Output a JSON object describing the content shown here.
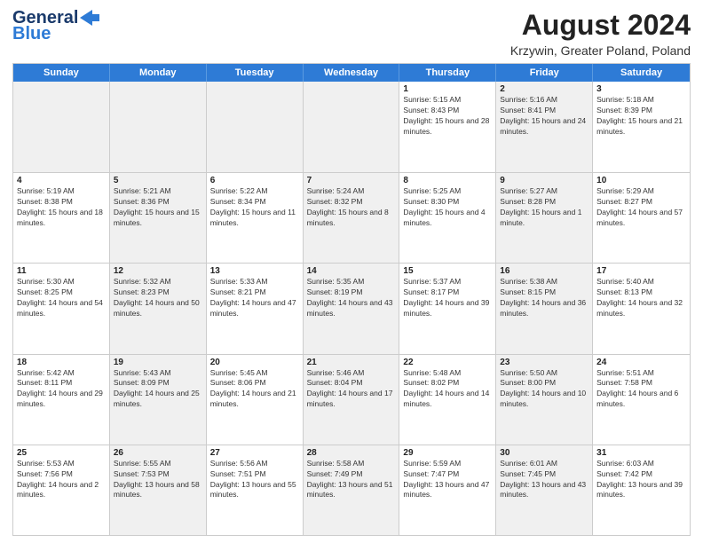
{
  "header": {
    "logo_line1": "General",
    "logo_line2": "Blue",
    "month_year": "August 2024",
    "location": "Krzywin, Greater Poland, Poland"
  },
  "days_of_week": [
    "Sunday",
    "Monday",
    "Tuesday",
    "Wednesday",
    "Thursday",
    "Friday",
    "Saturday"
  ],
  "weeks": [
    [
      {
        "day": "",
        "sunrise": "",
        "sunset": "",
        "daylight": "",
        "shaded": true
      },
      {
        "day": "",
        "sunrise": "",
        "sunset": "",
        "daylight": "",
        "shaded": true
      },
      {
        "day": "",
        "sunrise": "",
        "sunset": "",
        "daylight": "",
        "shaded": true
      },
      {
        "day": "",
        "sunrise": "",
        "sunset": "",
        "daylight": "",
        "shaded": true
      },
      {
        "day": "1",
        "sunrise": "Sunrise: 5:15 AM",
        "sunset": "Sunset: 8:43 PM",
        "daylight": "Daylight: 15 hours and 28 minutes.",
        "shaded": false
      },
      {
        "day": "2",
        "sunrise": "Sunrise: 5:16 AM",
        "sunset": "Sunset: 8:41 PM",
        "daylight": "Daylight: 15 hours and 24 minutes.",
        "shaded": true
      },
      {
        "day": "3",
        "sunrise": "Sunrise: 5:18 AM",
        "sunset": "Sunset: 8:39 PM",
        "daylight": "Daylight: 15 hours and 21 minutes.",
        "shaded": false
      }
    ],
    [
      {
        "day": "4",
        "sunrise": "Sunrise: 5:19 AM",
        "sunset": "Sunset: 8:38 PM",
        "daylight": "Daylight: 15 hours and 18 minutes.",
        "shaded": false
      },
      {
        "day": "5",
        "sunrise": "Sunrise: 5:21 AM",
        "sunset": "Sunset: 8:36 PM",
        "daylight": "Daylight: 15 hours and 15 minutes.",
        "shaded": true
      },
      {
        "day": "6",
        "sunrise": "Sunrise: 5:22 AM",
        "sunset": "Sunset: 8:34 PM",
        "daylight": "Daylight: 15 hours and 11 minutes.",
        "shaded": false
      },
      {
        "day": "7",
        "sunrise": "Sunrise: 5:24 AM",
        "sunset": "Sunset: 8:32 PM",
        "daylight": "Daylight: 15 hours and 8 minutes.",
        "shaded": true
      },
      {
        "day": "8",
        "sunrise": "Sunrise: 5:25 AM",
        "sunset": "Sunset: 8:30 PM",
        "daylight": "Daylight: 15 hours and 4 minutes.",
        "shaded": false
      },
      {
        "day": "9",
        "sunrise": "Sunrise: 5:27 AM",
        "sunset": "Sunset: 8:28 PM",
        "daylight": "Daylight: 15 hours and 1 minute.",
        "shaded": true
      },
      {
        "day": "10",
        "sunrise": "Sunrise: 5:29 AM",
        "sunset": "Sunset: 8:27 PM",
        "daylight": "Daylight: 14 hours and 57 minutes.",
        "shaded": false
      }
    ],
    [
      {
        "day": "11",
        "sunrise": "Sunrise: 5:30 AM",
        "sunset": "Sunset: 8:25 PM",
        "daylight": "Daylight: 14 hours and 54 minutes.",
        "shaded": false
      },
      {
        "day": "12",
        "sunrise": "Sunrise: 5:32 AM",
        "sunset": "Sunset: 8:23 PM",
        "daylight": "Daylight: 14 hours and 50 minutes.",
        "shaded": true
      },
      {
        "day": "13",
        "sunrise": "Sunrise: 5:33 AM",
        "sunset": "Sunset: 8:21 PM",
        "daylight": "Daylight: 14 hours and 47 minutes.",
        "shaded": false
      },
      {
        "day": "14",
        "sunrise": "Sunrise: 5:35 AM",
        "sunset": "Sunset: 8:19 PM",
        "daylight": "Daylight: 14 hours and 43 minutes.",
        "shaded": true
      },
      {
        "day": "15",
        "sunrise": "Sunrise: 5:37 AM",
        "sunset": "Sunset: 8:17 PM",
        "daylight": "Daylight: 14 hours and 39 minutes.",
        "shaded": false
      },
      {
        "day": "16",
        "sunrise": "Sunrise: 5:38 AM",
        "sunset": "Sunset: 8:15 PM",
        "daylight": "Daylight: 14 hours and 36 minutes.",
        "shaded": true
      },
      {
        "day": "17",
        "sunrise": "Sunrise: 5:40 AM",
        "sunset": "Sunset: 8:13 PM",
        "daylight": "Daylight: 14 hours and 32 minutes.",
        "shaded": false
      }
    ],
    [
      {
        "day": "18",
        "sunrise": "Sunrise: 5:42 AM",
        "sunset": "Sunset: 8:11 PM",
        "daylight": "Daylight: 14 hours and 29 minutes.",
        "shaded": false
      },
      {
        "day": "19",
        "sunrise": "Sunrise: 5:43 AM",
        "sunset": "Sunset: 8:09 PM",
        "daylight": "Daylight: 14 hours and 25 minutes.",
        "shaded": true
      },
      {
        "day": "20",
        "sunrise": "Sunrise: 5:45 AM",
        "sunset": "Sunset: 8:06 PM",
        "daylight": "Daylight: 14 hours and 21 minutes.",
        "shaded": false
      },
      {
        "day": "21",
        "sunrise": "Sunrise: 5:46 AM",
        "sunset": "Sunset: 8:04 PM",
        "daylight": "Daylight: 14 hours and 17 minutes.",
        "shaded": true
      },
      {
        "day": "22",
        "sunrise": "Sunrise: 5:48 AM",
        "sunset": "Sunset: 8:02 PM",
        "daylight": "Daylight: 14 hours and 14 minutes.",
        "shaded": false
      },
      {
        "day": "23",
        "sunrise": "Sunrise: 5:50 AM",
        "sunset": "Sunset: 8:00 PM",
        "daylight": "Daylight: 14 hours and 10 minutes.",
        "shaded": true
      },
      {
        "day": "24",
        "sunrise": "Sunrise: 5:51 AM",
        "sunset": "Sunset: 7:58 PM",
        "daylight": "Daylight: 14 hours and 6 minutes.",
        "shaded": false
      }
    ],
    [
      {
        "day": "25",
        "sunrise": "Sunrise: 5:53 AM",
        "sunset": "Sunset: 7:56 PM",
        "daylight": "Daylight: 14 hours and 2 minutes.",
        "shaded": false
      },
      {
        "day": "26",
        "sunrise": "Sunrise: 5:55 AM",
        "sunset": "Sunset: 7:53 PM",
        "daylight": "Daylight: 13 hours and 58 minutes.",
        "shaded": true
      },
      {
        "day": "27",
        "sunrise": "Sunrise: 5:56 AM",
        "sunset": "Sunset: 7:51 PM",
        "daylight": "Daylight: 13 hours and 55 minutes.",
        "shaded": false
      },
      {
        "day": "28",
        "sunrise": "Sunrise: 5:58 AM",
        "sunset": "Sunset: 7:49 PM",
        "daylight": "Daylight: 13 hours and 51 minutes.",
        "shaded": true
      },
      {
        "day": "29",
        "sunrise": "Sunrise: 5:59 AM",
        "sunset": "Sunset: 7:47 PM",
        "daylight": "Daylight: 13 hours and 47 minutes.",
        "shaded": false
      },
      {
        "day": "30",
        "sunrise": "Sunrise: 6:01 AM",
        "sunset": "Sunset: 7:45 PM",
        "daylight": "Daylight: 13 hours and 43 minutes.",
        "shaded": true
      },
      {
        "day": "31",
        "sunrise": "Sunrise: 6:03 AM",
        "sunset": "Sunset: 7:42 PM",
        "daylight": "Daylight: 13 hours and 39 minutes.",
        "shaded": false
      }
    ]
  ]
}
